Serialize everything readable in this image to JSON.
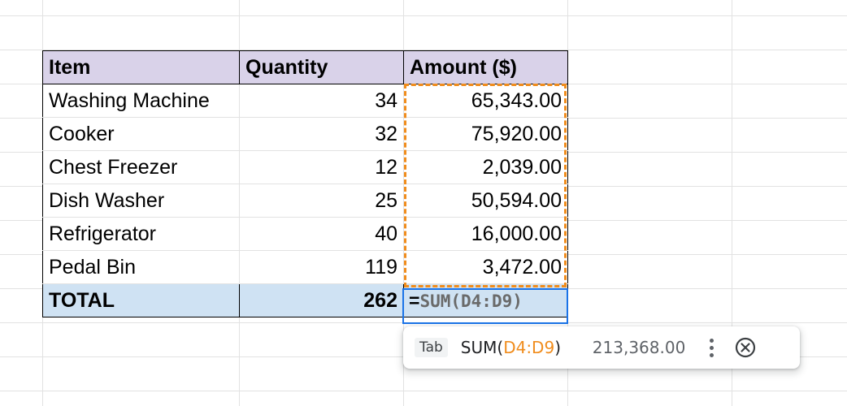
{
  "table": {
    "headers": [
      "Item",
      "Quantity",
      "Amount ($)"
    ],
    "rows": [
      {
        "item": "Washing Machine",
        "quantity": "34",
        "amount": "65,343.00"
      },
      {
        "item": "Cooker",
        "quantity": "32",
        "amount": "75,920.00"
      },
      {
        "item": "Chest Freezer",
        "quantity": "12",
        "amount": "2,039.00"
      },
      {
        "item": "Dish Washer",
        "quantity": "25",
        "amount": "50,594.00"
      },
      {
        "item": "Refrigerator",
        "quantity": "40",
        "amount": "16,000.00"
      },
      {
        "item": "Pedal Bin",
        "quantity": "119",
        "amount": "3,472.00"
      }
    ],
    "total": {
      "label": "TOTAL",
      "quantity": "262"
    }
  },
  "editing": {
    "typed": "=",
    "ghost": "SUM(D4:D9)"
  },
  "suggestion": {
    "key": "Tab",
    "function": "SUM(",
    "range": "D4:D9",
    "close_paren": ")",
    "preview_value": "213,368.00",
    "more_icon": "more-vert-icon",
    "close_icon": "close-circle-icon"
  },
  "colors": {
    "header_bg": "#d9d2e9",
    "total_bg": "#cfe2f3",
    "range_highlight": "#f08c1c",
    "active_cell": "#1a73e8"
  }
}
